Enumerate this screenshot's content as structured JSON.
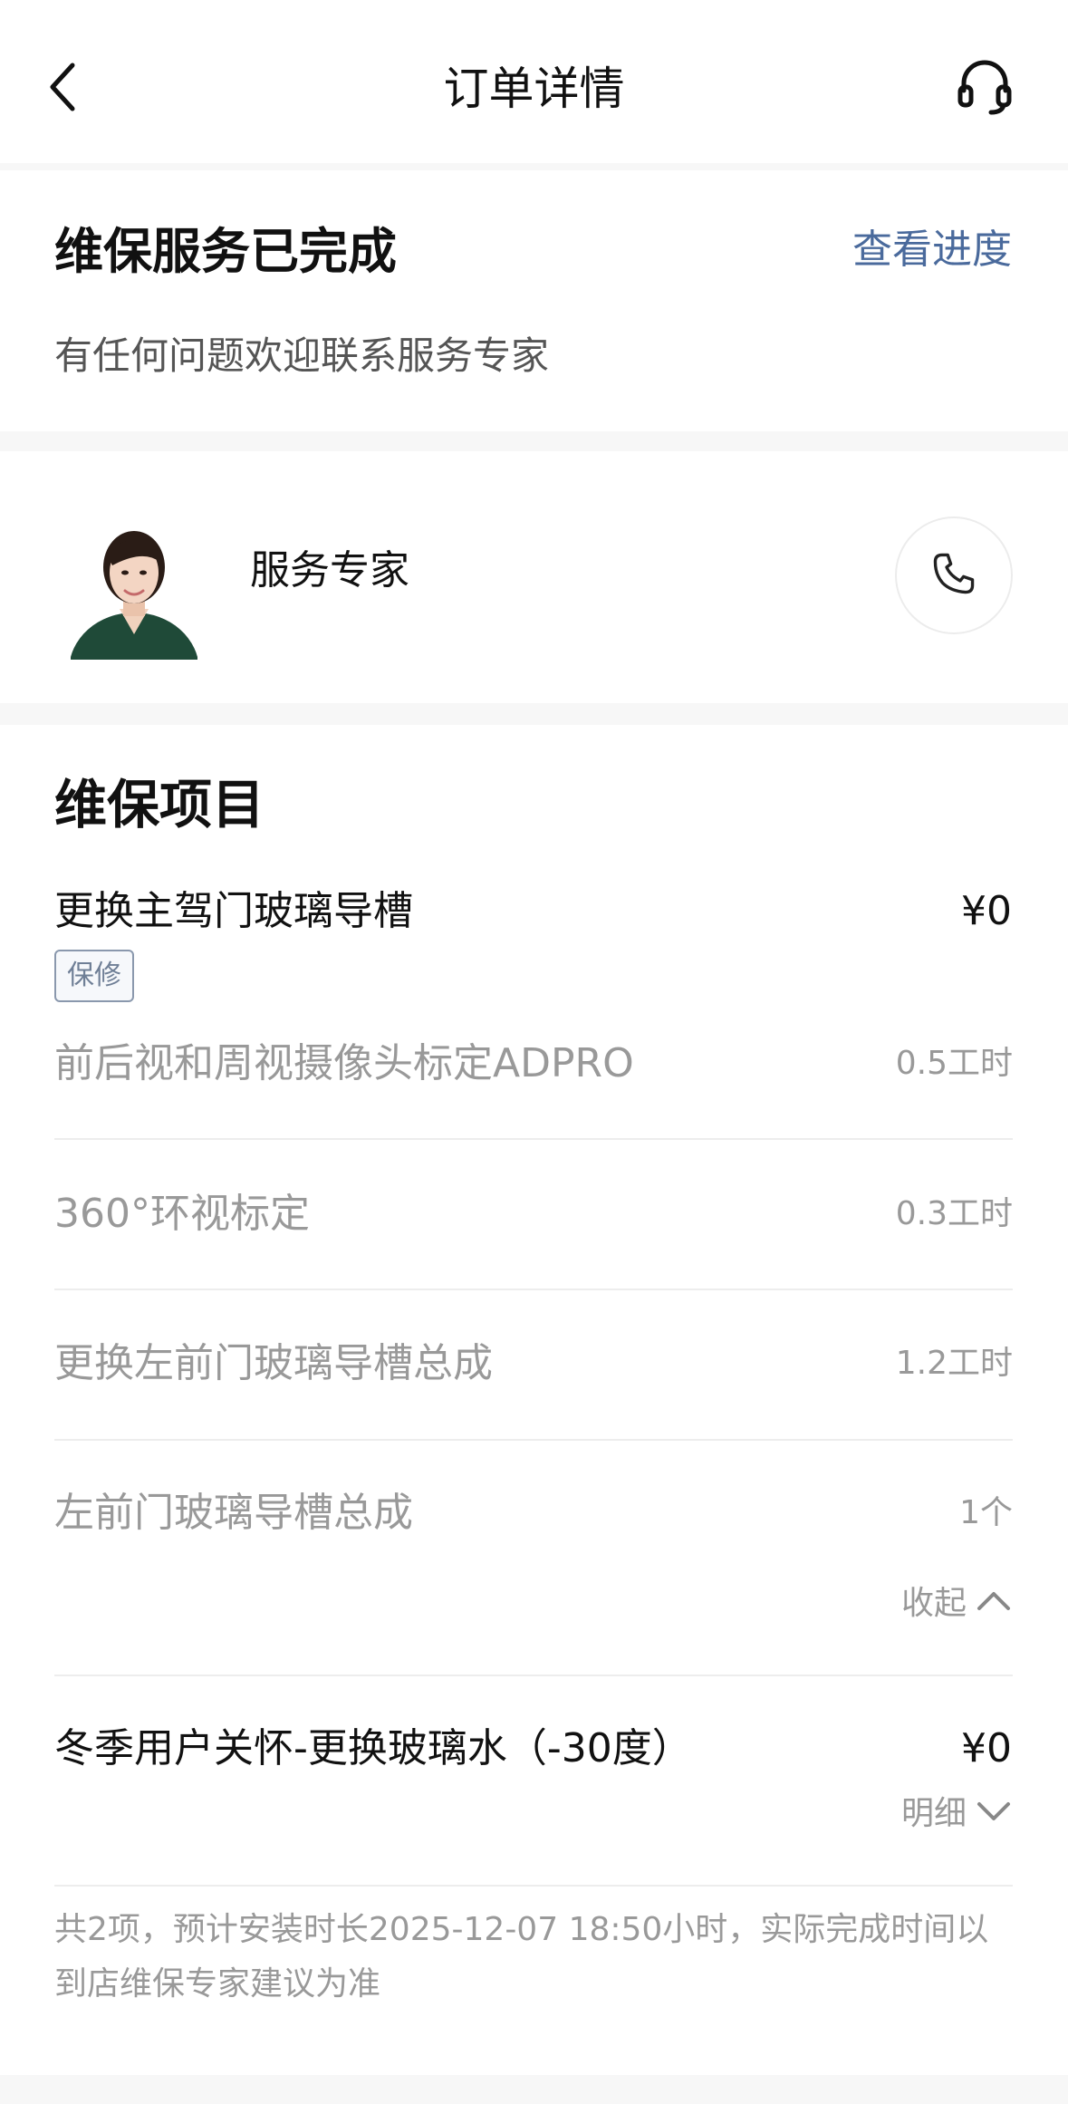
{
  "nav": {
    "title": "订单详情",
    "back_icon": "chevron-left-icon",
    "service_icon": "headset-icon"
  },
  "status": {
    "title": "维保服务已完成",
    "link": "查看进度",
    "subtitle": "有任何问题欢迎联系服务专家"
  },
  "expert": {
    "name": "服务专家",
    "call_icon": "phone-icon"
  },
  "items": {
    "title": "维保项目",
    "main": {
      "name": "更换主驾门玻璃导槽",
      "price": "¥0",
      "tag": "保修",
      "sub_items": [
        {
          "name": "前后视和周视摄像头标定ADPRO",
          "qty": "0.5工时"
        },
        {
          "name": "360°环视标定",
          "qty": "0.3工时"
        },
        {
          "name": "更换左前门玻璃导槽总成",
          "qty": "1.2工时"
        },
        {
          "name": "左前门玻璃导槽总成",
          "qty": "1个"
        }
      ],
      "toggle": "收起"
    },
    "second": {
      "name": "冬季用户关怀-更换玻璃水（-30度）",
      "price": "¥0",
      "toggle": "明细"
    },
    "summary": "共2项，预计安装时长2025-12-07 18:50小时，实际完成时间以到店维保专家建议为准"
  },
  "colors": {
    "link": "#4a6a9c",
    "secondary_text": "#999999",
    "tag_border": "#8a98ad",
    "background": "#f7f7f7"
  }
}
